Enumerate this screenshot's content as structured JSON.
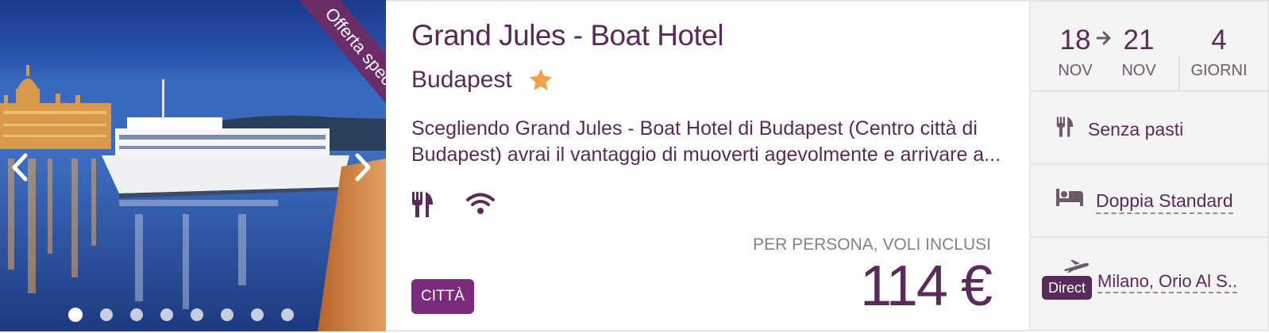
{
  "gallery": {
    "ribbon": "Offerta speciale",
    "dots_total": 8,
    "active_index": 0
  },
  "hotel": {
    "name": "Grand Jules - Boat Hotel",
    "city": "Budapest",
    "stars": 1,
    "description_line1": "Scegliendo Grand Jules - Boat Hotel di Budapest (Centro città di",
    "description_line2": "Budapest) avrai il vantaggio di muoverti agevolmente e arrivare a...",
    "amenities": [
      "restaurant-icon",
      "wifi-icon"
    ],
    "category_badge": "CITTÀ"
  },
  "price": {
    "label": "PER PERSONA, VOLI INCLUSI",
    "amount": "114 €"
  },
  "trip": {
    "from_day": "18",
    "from_month": "NOV",
    "to_day": "21",
    "to_month": "NOV",
    "days": "4",
    "days_label": "GIORNI",
    "meal": "Senza pasti",
    "room": "Doppia Standard",
    "flight_badge": "Direct",
    "flight_airport": "Milano, Orio Al S.."
  },
  "colors": {
    "brand": "#5a2a5a",
    "badge": "#7b2a7c",
    "star": "#f0a348"
  }
}
